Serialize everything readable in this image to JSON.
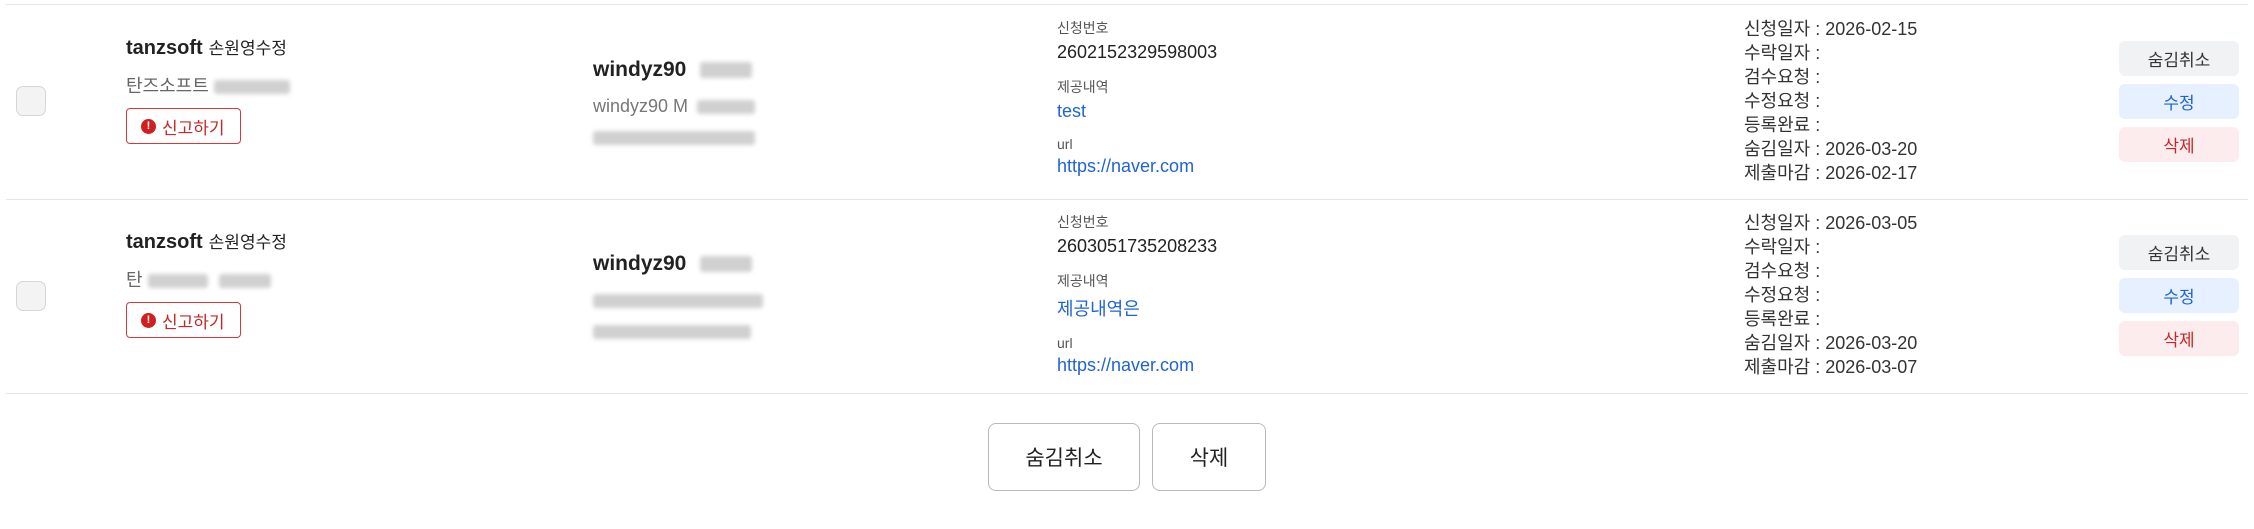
{
  "rows": [
    {
      "company_title": "tanzsoft",
      "company_subtitle": "손원영수정",
      "company_name_prefix": "탄즈소프트",
      "report_label": "신고하기",
      "user_id": "windyz90",
      "user_line": "windyz90 M",
      "request_no_label": "신청번호",
      "request_no": "2602152329598003",
      "provided_label": "제공내역",
      "provided": "test",
      "url_label": "url",
      "url": "https://naver.com",
      "dates": [
        "신청일자 : 2026-02-15",
        "수락일자 :",
        "검수요청 :",
        "수정요청 :",
        "등록완료 :",
        "숨김일자 : 2026-03-20",
        "제출마감 : 2026-02-17"
      ],
      "actions": {
        "unhide": "숨김취소",
        "edit": "수정",
        "delete": "삭제"
      }
    },
    {
      "company_title": "tanzsoft",
      "company_subtitle": "손원영수정",
      "company_name_prefix": "탄",
      "report_label": "신고하기",
      "user_id": "windyz90",
      "user_line": "",
      "request_no_label": "신청번호",
      "request_no": "2603051735208233",
      "provided_label": "제공내역",
      "provided": "제공내역은",
      "url_label": "url",
      "url": "https://naver.com",
      "dates": [
        "신청일자 : 2026-03-05",
        "수락일자 :",
        "검수요청 :",
        "수정요청 :",
        "등록완료 :",
        "숨김일자 : 2026-03-20",
        "제출마감 : 2026-03-07"
      ],
      "actions": {
        "unhide": "숨김취소",
        "edit": "수정",
        "delete": "삭제"
      }
    }
  ],
  "bottom_actions": {
    "unhide": "숨김취소",
    "delete": "삭제"
  },
  "colors": {
    "link": "#1f63d6",
    "danger": "#c62828",
    "edit_bg": "#e6f0ff",
    "delete_bg": "#fdecee"
  },
  "icons": {
    "report": "exclamation-circle-icon"
  }
}
